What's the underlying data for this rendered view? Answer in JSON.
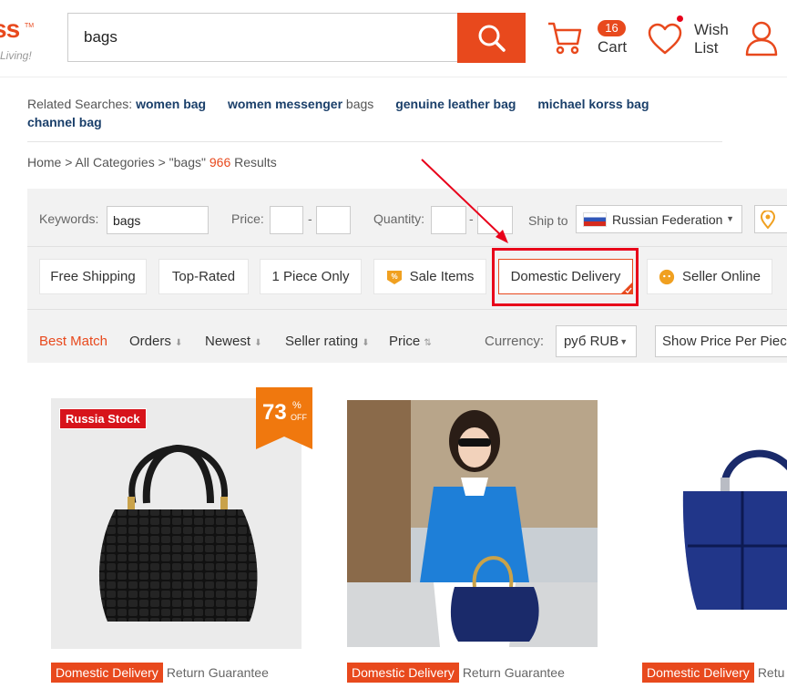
{
  "header": {
    "logo_text": "ss",
    "logo_tm": "TM",
    "logo_tagline": "Living!",
    "search_value": "bags",
    "cart_count": "16",
    "cart_label": "Cart",
    "wish_line1": "Wish",
    "wish_line2": "List"
  },
  "related": {
    "prefix": "Related Searches:",
    "items": [
      {
        "bold": "women bag",
        "light": ""
      },
      {
        "bold": "women messenger",
        "light": " bags"
      },
      {
        "bold": "genuine leather bag",
        "light": ""
      },
      {
        "bold": "michael korss bag",
        "light": ""
      },
      {
        "bold": "channel bag",
        "light": ""
      }
    ]
  },
  "breadcrumb": {
    "home": "Home",
    "sep": " > ",
    "all_categories": "All Categories",
    "query": "\"bags\"",
    "count": "966",
    "results_label": "Results"
  },
  "filters": {
    "keywords_label": "Keywords:",
    "keywords_value": "bags",
    "price_label": "Price:",
    "quantity_label": "Quantity:",
    "dash": "-",
    "ship_to_label": "Ship to",
    "ship_to_value": "Russian Federation",
    "chips": {
      "free_shipping": "Free Shipping",
      "top_rated": "Top-Rated",
      "one_piece": "1 Piece Only",
      "sale_items": "Sale Items",
      "domestic_delivery": "Domestic Delivery",
      "seller_online": "Seller Online"
    }
  },
  "sort": {
    "best_match": "Best Match",
    "orders": "Orders",
    "newest": "Newest",
    "seller_rating": "Seller rating",
    "price": "Price",
    "currency_label": "Currency:",
    "currency_value": "руб RUB",
    "show_price": "Show Price Per Piece"
  },
  "products": [
    {
      "stock_label": "Russia Stock",
      "discount": "73",
      "discount_pct": "%",
      "discount_off": "OFF",
      "delivery_tag": "Domestic Delivery",
      "guarantee": "Return Guarantee"
    },
    {
      "delivery_tag": "Domestic Delivery",
      "guarantee": "Return Guarantee"
    },
    {
      "delivery_tag": "Domestic Delivery",
      "guarantee": "Retu"
    }
  ],
  "colors": {
    "accent": "#e8491d",
    "link": "#1a3f6a",
    "annotation": "#e8001a"
  }
}
